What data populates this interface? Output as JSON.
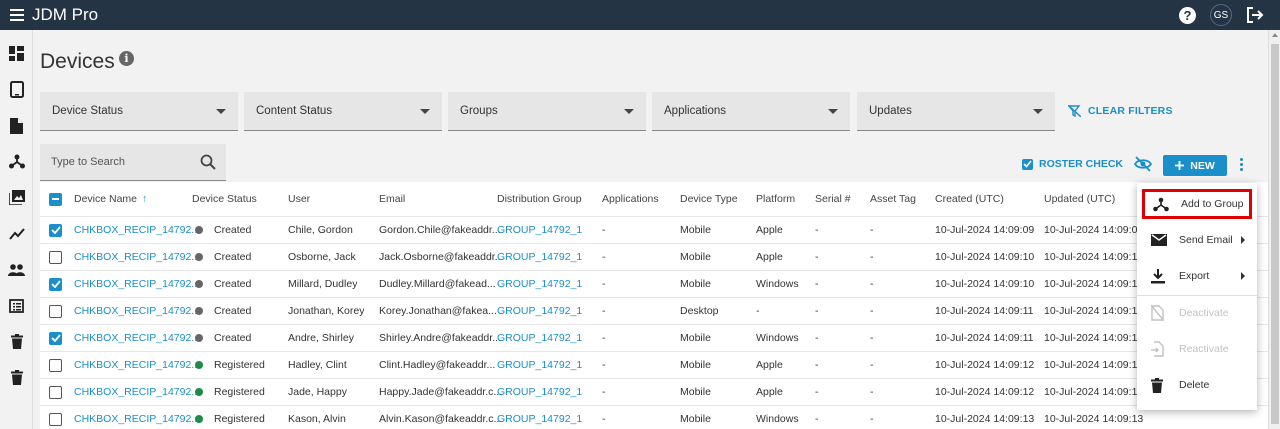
{
  "app": {
    "title": "JDM Pro",
    "user_initials": "GS"
  },
  "colors": {
    "topbar": "#243444",
    "accent": "#1a8fc9",
    "highlight_border": "#e00000"
  },
  "page": {
    "title": "Devices"
  },
  "filters": [
    {
      "label": "Device Status"
    },
    {
      "label": "Content Status"
    },
    {
      "label": "Groups"
    },
    {
      "label": "Applications"
    },
    {
      "label": "Updates"
    }
  ],
  "clear_filters_label": "CLEAR FILTERS",
  "search": {
    "placeholder": "Type to Search"
  },
  "toolbar": {
    "roster_check_label": "ROSTER CHECK",
    "new_label": "NEW"
  },
  "table": {
    "columns": [
      "Device Name",
      "Device Status",
      "User",
      "Email",
      "Distribution Group",
      "Applications",
      "Device Type",
      "Platform",
      "Serial #",
      "Asset Tag",
      "Created (UTC)",
      "Updated (UTC)"
    ],
    "sort_indicator": "↑",
    "rows": [
      {
        "checked": true,
        "name": "CHKBOX_RECIP_14792...",
        "status": "Created",
        "status_color": "#666666",
        "user": "Chile, Gordon",
        "email": "Gordon.Chile@fakeaddr...",
        "group": "GROUP_14792_1",
        "apps": "-",
        "type": "Mobile",
        "platform": "Apple",
        "serial": "-",
        "asset": "-",
        "created": "10-Jul-2024 14:09:09",
        "updated": "10-Jul-2024 14:09:09"
      },
      {
        "checked": false,
        "name": "CHKBOX_RECIP_14792...",
        "status": "Created",
        "status_color": "#666666",
        "user": "Osborne, Jack",
        "email": "Jack.Osborne@fakeaddr...",
        "group": "GROUP_14792_1",
        "apps": "-",
        "type": "Mobile",
        "platform": "Apple",
        "serial": "-",
        "asset": "-",
        "created": "10-Jul-2024 14:09:10",
        "updated": "10-Jul-2024 14:09:10"
      },
      {
        "checked": true,
        "name": "CHKBOX_RECIP_14792...",
        "status": "Created",
        "status_color": "#666666",
        "user": "Millard, Dudley",
        "email": "Dudley.Millard@fakead...",
        "group": "GROUP_14792_1",
        "apps": "-",
        "type": "Mobile",
        "platform": "Windows",
        "serial": "-",
        "asset": "-",
        "created": "10-Jul-2024 14:09:10",
        "updated": "10-Jul-2024 14:09:10"
      },
      {
        "checked": false,
        "name": "CHKBOX_RECIP_14792...",
        "status": "Created",
        "status_color": "#666666",
        "user": "Jonathan, Korey",
        "email": "Korey.Jonathan@fakea...",
        "group": "GROUP_14792_1",
        "apps": "-",
        "type": "Desktop",
        "platform": "-",
        "serial": "-",
        "asset": "-",
        "created": "10-Jul-2024 14:09:11",
        "updated": "10-Jul-2024 14:09:11"
      },
      {
        "checked": true,
        "name": "CHKBOX_RECIP_14792...",
        "status": "Created",
        "status_color": "#666666",
        "user": "Andre, Shirley",
        "email": "Shirley.Andre@fakeaddr...",
        "group": "GROUP_14792_1",
        "apps": "-",
        "type": "Mobile",
        "platform": "Windows",
        "serial": "-",
        "asset": "-",
        "created": "10-Jul-2024 14:09:11",
        "updated": "10-Jul-2024 14:09:11"
      },
      {
        "checked": false,
        "name": "CHKBOX_RECIP_14792...",
        "status": "Registered",
        "status_color": "#1e8a4a",
        "user": "Hadley, Clint",
        "email": "Clint.Hadley@fakeaddr...",
        "group": "GROUP_14792_1",
        "apps": "-",
        "type": "Mobile",
        "platform": "Apple",
        "serial": "-",
        "asset": "-",
        "created": "10-Jul-2024 14:09:12",
        "updated": "10-Jul-2024 14:09:12"
      },
      {
        "checked": false,
        "name": "CHKBOX_RECIP_14792...",
        "status": "Registered",
        "status_color": "#1e8a4a",
        "user": "Jade, Happy",
        "email": "Happy.Jade@fakeaddr.c...",
        "group": "GROUP_14792_1",
        "apps": "-",
        "type": "Mobile",
        "platform": "Apple",
        "serial": "-",
        "asset": "-",
        "created": "10-Jul-2024 14:09:12",
        "updated": "10-Jul-2024 14:09:12"
      },
      {
        "checked": false,
        "name": "CHKBOX_RECIP_14792...",
        "status": "Registered",
        "status_color": "#1e8a4a",
        "user": "Kason, Alvin",
        "email": "Alvin.Kason@fakeaddr.c...",
        "group": "GROUP_14792_1",
        "apps": "-",
        "type": "Mobile",
        "platform": "Windows",
        "serial": "-",
        "asset": "-",
        "created": "10-Jul-2024 14:09:13",
        "updated": "10-Jul-2024 14:09:13"
      }
    ]
  },
  "menu": {
    "items": [
      {
        "label": "Add to Group",
        "icon": "share-hub-icon",
        "disabled": false,
        "submenu": false
      },
      {
        "label": "Send Email",
        "icon": "mail-icon",
        "disabled": false,
        "submenu": true
      },
      {
        "label": "Export",
        "icon": "download-icon",
        "disabled": false,
        "submenu": true
      },
      {
        "label": "Deactivate",
        "icon": "file-off-icon",
        "disabled": true,
        "submenu": false
      },
      {
        "label": "Reactivate",
        "icon": "file-restore-icon",
        "disabled": true,
        "submenu": false
      },
      {
        "label": "Delete",
        "icon": "trash-icon",
        "disabled": false,
        "submenu": false
      }
    ]
  }
}
